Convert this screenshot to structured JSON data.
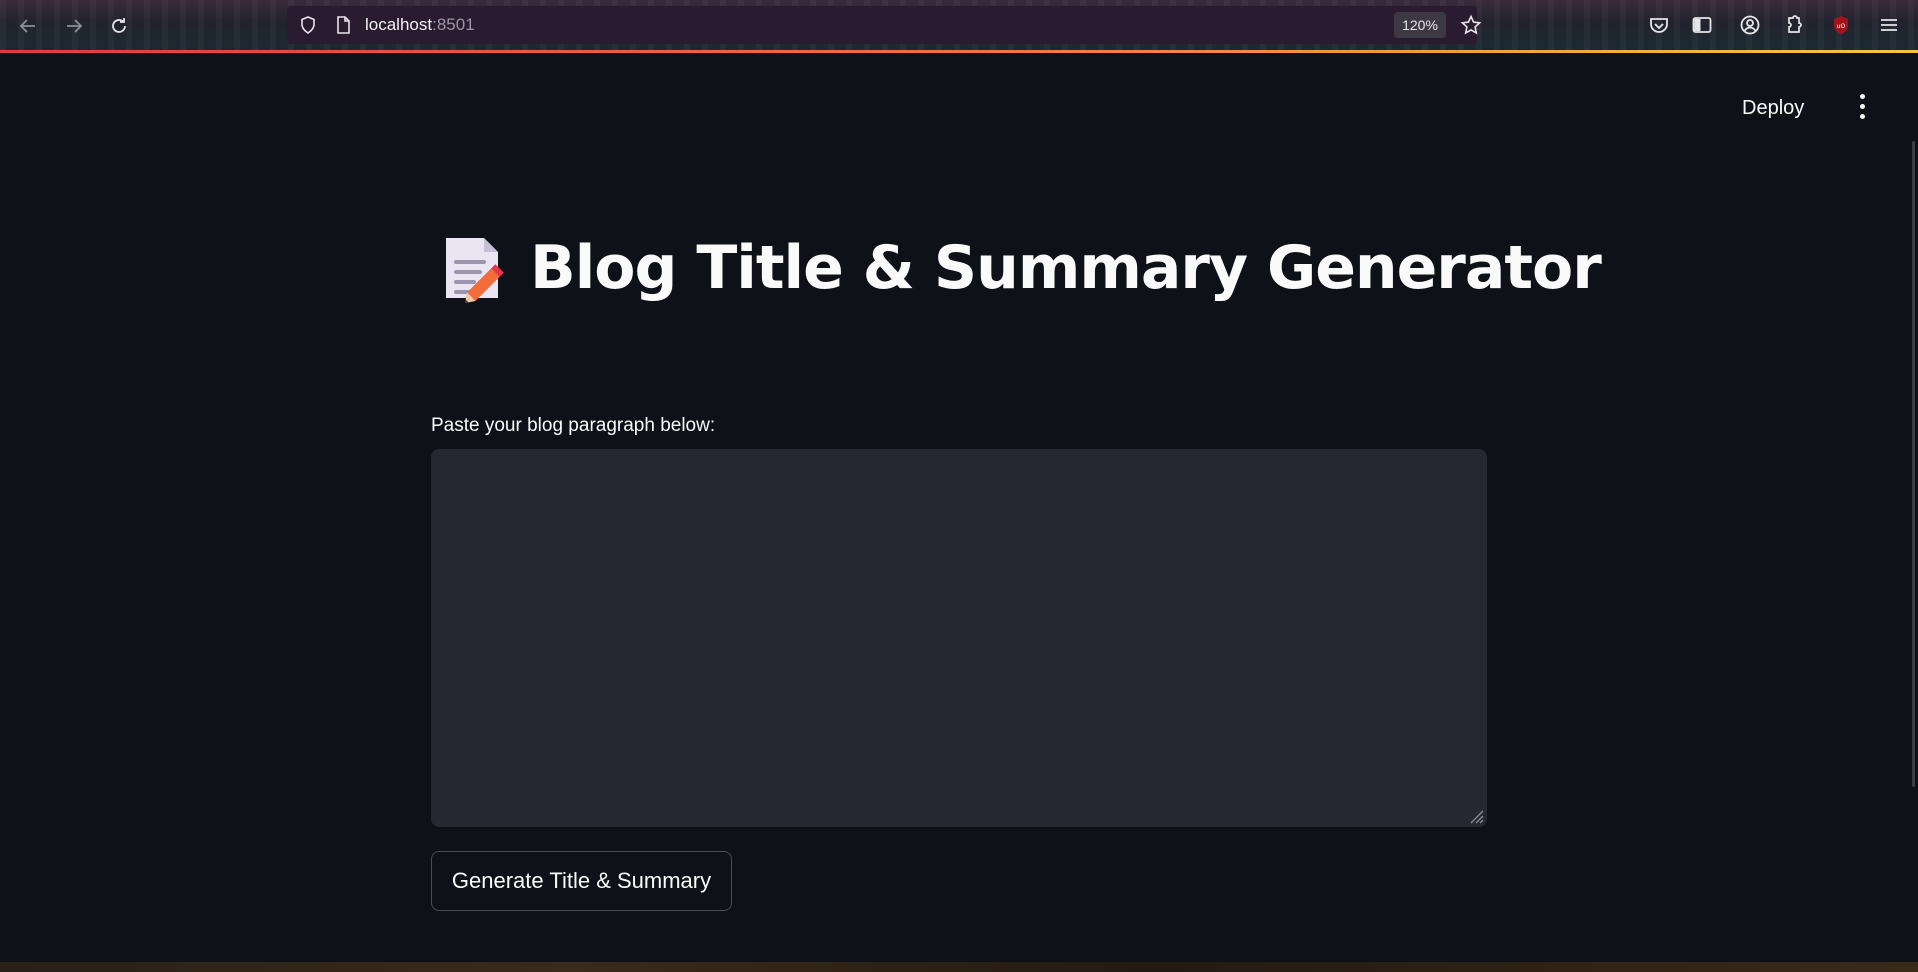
{
  "browser": {
    "url_host": "localhost",
    "url_port": ":8501",
    "zoom": "120%",
    "icons": [
      "back-arrow-icon",
      "forward-arrow-icon",
      "reload-icon",
      "shield-icon",
      "page-icon",
      "star-icon",
      "pocket-icon",
      "sidebar-icon",
      "account-icon",
      "extensions-icon",
      "ublock-icon",
      "menu-icon"
    ]
  },
  "app": {
    "deploy_label": "Deploy",
    "title": "Blog Title & Summary Generator",
    "title_emoji_icon": "memo-icon",
    "input_label": "Paste your blog paragraph below:",
    "input_value": "",
    "button_label": "Generate Title & Summary"
  },
  "colors": {
    "background": "#0e1117",
    "textarea_bg": "#262730",
    "text": "#fafafa",
    "accent_gradient": [
      "#e3374a",
      "#f26a3c",
      "#f5c542"
    ]
  }
}
